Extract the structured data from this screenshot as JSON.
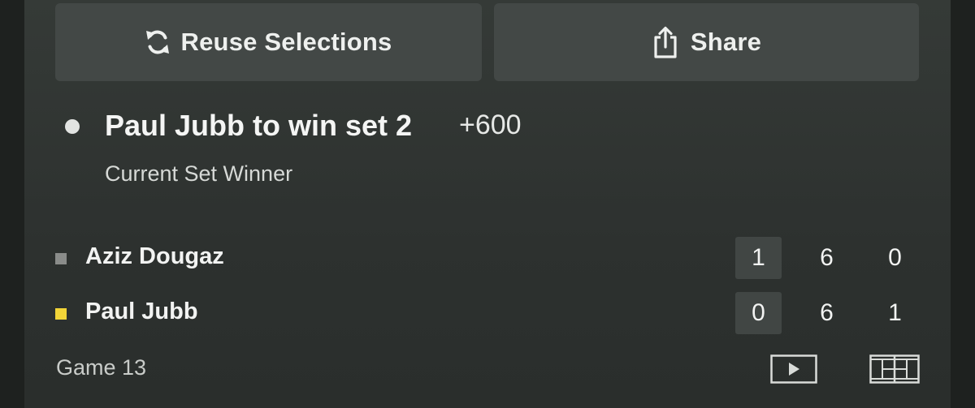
{
  "actions": {
    "reuse_label": "Reuse Selections",
    "reuse_icon": "refresh-icon",
    "share_label": "Share",
    "share_icon": "share-icon"
  },
  "selection": {
    "title": "Paul Jubb to win set 2",
    "odds": "+600",
    "market": "Current Set Winner"
  },
  "scoreboard": {
    "players": [
      {
        "name": "Aziz Dougaz",
        "marker_color": "#8a8c8a",
        "scores": [
          "1",
          "6",
          "0"
        ]
      },
      {
        "name": "Paul Jubb",
        "marker_color": "#f2d438",
        "scores": [
          "0",
          "6",
          "1"
        ]
      }
    ],
    "status": "Game 13",
    "icons": [
      "play-icon",
      "court-icon"
    ]
  },
  "colors": {
    "background": "#2f3331",
    "button": "#434846",
    "current_set_highlight": "#414644",
    "server_marker": "#f2d438"
  }
}
